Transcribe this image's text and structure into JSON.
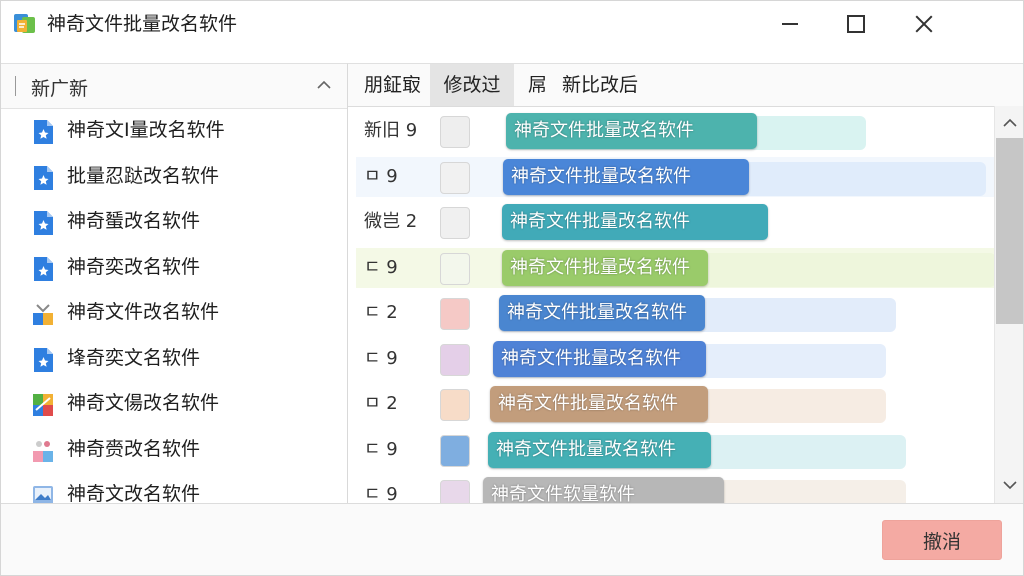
{
  "window": {
    "title": "神奇文件批量改名软件",
    "controls": [
      "minimize",
      "maximize",
      "close"
    ]
  },
  "left_panel": {
    "header_label": "新广新",
    "items": [
      {
        "name": "神奇文I量改名软件",
        "icon": "blue-file-icon"
      },
      {
        "name": "批量忍跶改名软件",
        "icon": "blue-file-icon"
      },
      {
        "name": "神奇蜑改名软件",
        "icon": "blue-file-icon"
      },
      {
        "name": "神奇奕改名软件",
        "icon": "blue-file-icon"
      },
      {
        "name": "神奇文件改名软件",
        "icon": "multicolor-file-icon"
      },
      {
        "name": "埄奇奕文名软件",
        "icon": "blue-file-icon"
      },
      {
        "name": "神奇文偒改名软件",
        "icon": "green-grid-file-icon"
      },
      {
        "name": "神奇赍改名软件",
        "icon": "pink-blue-file-icon"
      },
      {
        "name": "神奇文改名软件",
        "icon": "image-file-icon"
      }
    ]
  },
  "right_panel": {
    "columns": [
      {
        "label": "朋鉦㝡",
        "active": false
      },
      {
        "label": "修改过",
        "active": true
      },
      {
        "label": "屌",
        "active": false
      },
      {
        "label": "新比改后",
        "active": false
      }
    ],
    "rows": [
      {
        "meta": "新旧 9",
        "pill_text": "神奇文件批量改名软件",
        "pill_color": "#4db3ad",
        "thumb_color": "#eeeeee",
        "row_bg": "#ffffff",
        "ghost_color": "#d9f3f1"
      },
      {
        "meta": "ㅁ 9",
        "pill_text": "神奇文件批量改名软件",
        "pill_color": "#4a86d8",
        "thumb_color": "#f1f1f1",
        "row_bg": "#f2f7fd",
        "ghost_color": "#e0ecfb"
      },
      {
        "meta": "微岂 2",
        "pill_text": "神奇文件批量改名软件",
        "pill_color": "#41aab8",
        "thumb_color": "#f0f0f0",
        "row_bg": "#ffffff",
        "ghost_color": "#ffffff"
      },
      {
        "meta": "ㄷ 9",
        "pill_text": "神奇文件批量改名软件",
        "pill_color": "#9acb6a",
        "thumb_color": "#f3f7ec",
        "row_bg": "#f4f9e6",
        "ghost_color": "#eef6dc"
      },
      {
        "meta": "ㄷ 2",
        "pill_text": "神奇文件批量改名软件",
        "pill_color": "#4a86d0",
        "thumb_color": "#f5c9c6",
        "row_bg": "#ffffff",
        "ghost_color": "#e2ecfa"
      },
      {
        "meta": "ㄷ 9",
        "pill_text": "神奇文件批量改名软件",
        "pill_color": "#4f82d6",
        "thumb_color": "#e4cfe8",
        "row_bg": "#ffffff",
        "ghost_color": "#e5eefb"
      },
      {
        "meta": "ㅁ 2",
        "pill_text": "神奇文件批量改名软件",
        "pill_color": "#c29d7c",
        "thumb_color": "#f7dcc8",
        "row_bg": "#ffffff",
        "ghost_color": "#f6ece3"
      },
      {
        "meta": "ㄷ 9",
        "pill_text": "神奇文件批量改名软件",
        "pill_color": "#45b0b5",
        "thumb_color": "#7faee0",
        "row_bg": "#ffffff",
        "ghost_color": "#dcf1f3"
      },
      {
        "meta": "ㄷ 9",
        "pill_text": "神奇文件软量软件",
        "pill_color": "#b7b7b7",
        "thumb_color": "#e8d8ea",
        "row_bg": "#ffffff",
        "ghost_color": "#f5efe8"
      }
    ]
  },
  "footer": {
    "cancel_label": "撤消"
  },
  "colors": {
    "cancel_button": "#f4aaa3",
    "scroll_thumb": "#c6c6c6",
    "active_column": "#e4e4e4"
  }
}
